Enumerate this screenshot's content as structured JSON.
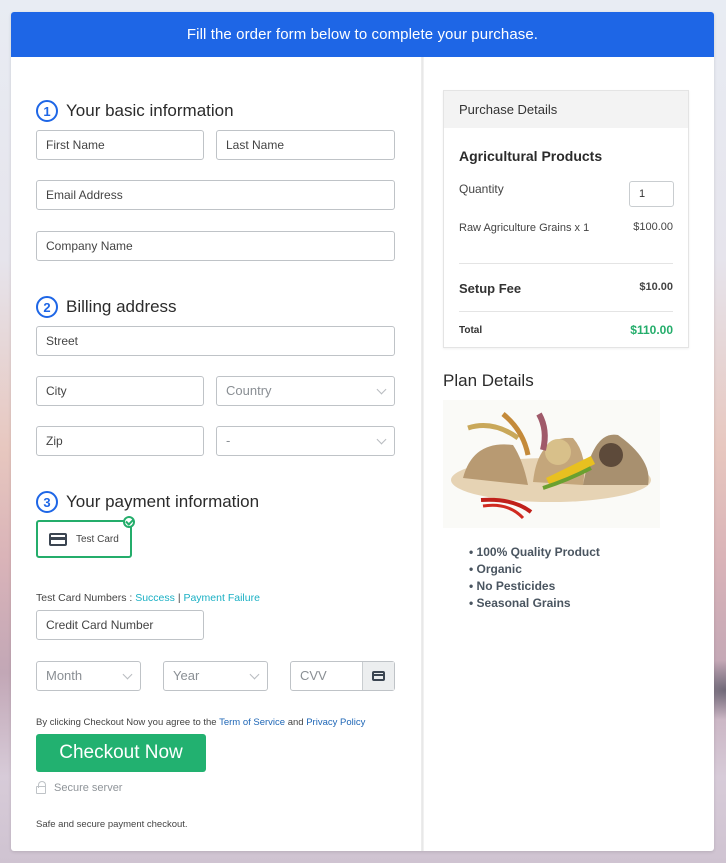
{
  "banner": {
    "text": "Fill the order form below to complete your purchase."
  },
  "sections": {
    "basic": {
      "step": "1",
      "title": "Your basic information"
    },
    "billing": {
      "step": "2",
      "title": "Billing address"
    },
    "payment": {
      "step": "3",
      "title": "Your payment information"
    }
  },
  "fields": {
    "first_name": {
      "placeholder": "First Name",
      "value": ""
    },
    "last_name": {
      "placeholder": "Last Name",
      "value": ""
    },
    "email": {
      "placeholder": "Email Address",
      "value": ""
    },
    "company": {
      "placeholder": "Company Name",
      "value": ""
    },
    "street": {
      "placeholder": "Street",
      "value": ""
    },
    "city": {
      "placeholder": "City",
      "value": ""
    },
    "country": {
      "selected": "Country"
    },
    "zip": {
      "placeholder": "Zip",
      "value": ""
    },
    "state": {
      "selected": "-"
    },
    "card_number": {
      "placeholder": "Credit Card Number",
      "value": ""
    },
    "month": {
      "selected": "Month"
    },
    "year": {
      "selected": "Year"
    },
    "cvv": {
      "placeholder": "CVV",
      "value": ""
    }
  },
  "payment": {
    "method_label": "Test Card",
    "method_selected": true,
    "test_numbers_label": "Test Card Numbers :",
    "success_link": "Success",
    "separator": "|",
    "failure_link": "Payment Failure"
  },
  "terms": {
    "prefix": "By clicking Checkout Now you agree to the",
    "tos_link": "Term of Service",
    "and": "and",
    "privacy_link": "Privacy Policy"
  },
  "checkout": {
    "button_label": "Checkout Now",
    "secure_label": "Secure server",
    "safe_note": "Safe and secure payment checkout."
  },
  "purchase": {
    "header": "Purchase Details",
    "product_title": "Agricultural Products",
    "quantity_label": "Quantity",
    "quantity_value": "1",
    "item_label": "Raw Agriculture Grains x 1",
    "item_price": "$100.00",
    "setup_fee_label": "Setup Fee",
    "setup_fee_value": "$10.00",
    "total_label": "Total",
    "total_value": "$110.00"
  },
  "plan": {
    "title": "Plan Details",
    "image_alt": "agricultural-grains-image",
    "features": [
      "100% Quality Product",
      "Organic",
      "No Pesticides",
      "Seasonal Grains"
    ]
  },
  "colors": {
    "brand_blue": "#1e66e6",
    "accent_green": "#22b170",
    "total_green": "#24ad6b",
    "link_teal": "#1ab0c4"
  }
}
